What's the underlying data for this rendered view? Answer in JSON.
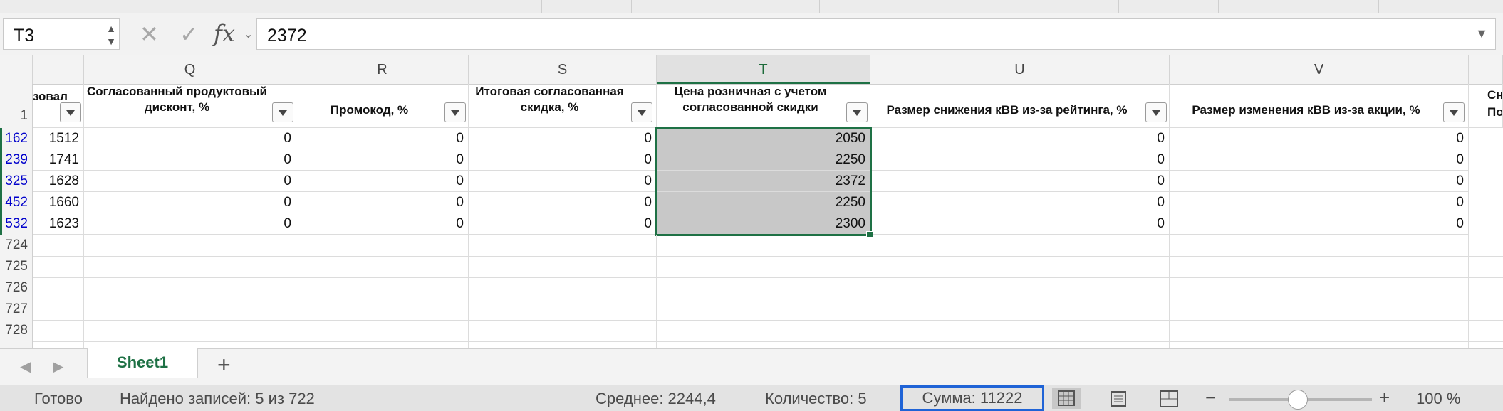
{
  "formula_bar": {
    "name_box": "T3",
    "fx_label": "fx",
    "formula": "2372"
  },
  "columns": [
    {
      "letter": "Q",
      "selected": false
    },
    {
      "letter": "R",
      "selected": false
    },
    {
      "letter": "S",
      "selected": false
    },
    {
      "letter": "T",
      "selected": true
    },
    {
      "letter": "U",
      "selected": false
    },
    {
      "letter": "V",
      "selected": false
    }
  ],
  "header_row_number": "1",
  "headers": {
    "p_partial": "зовал",
    "q": "Согласованный продуктовый дисконт, %",
    "r": "Промокод, %",
    "s": "Итоговая согласованная скидка, %",
    "t": "Цена розничная с учетом согласованной скидки",
    "u": "Размер снижения кВВ из-за рейтинга, %",
    "v": "Размер изменения кВВ из-за акции, %",
    "w_partial_top": "Сн",
    "w_partial_bottom": "По"
  },
  "rows": [
    {
      "num": "162",
      "p": "1512",
      "q": "0",
      "r": "0",
      "s": "0",
      "t": "2050",
      "u": "0",
      "v": "0"
    },
    {
      "num": "239",
      "p": "1741",
      "q": "0",
      "r": "0",
      "s": "0",
      "t": "2250",
      "u": "0",
      "v": "0"
    },
    {
      "num": "325",
      "p": "1628",
      "q": "0",
      "r": "0",
      "s": "0",
      "t": "2372",
      "u": "0",
      "v": "0"
    },
    {
      "num": "452",
      "p": "1660",
      "q": "0",
      "r": "0",
      "s": "0",
      "t": "2250",
      "u": "0",
      "v": "0"
    },
    {
      "num": "532",
      "p": "1623",
      "q": "0",
      "r": "0",
      "s": "0",
      "t": "2300",
      "u": "0",
      "v": "0"
    }
  ],
  "empty_rows": [
    "724",
    "725",
    "726",
    "727",
    "728"
  ],
  "sheet_tabs": {
    "active": "Sheet1",
    "add_label": "+"
  },
  "status": {
    "ready": "Готово",
    "found": "Найдено записей: 5 из 722",
    "average": "Среднее: 2244,4",
    "count": "Количество: 5",
    "sum": "Сумма: 11222",
    "zoom_minus": "−",
    "zoom_plus": "+",
    "zoom": "100 %",
    "zoom_level_fraction": 0.42
  },
  "colors": {
    "accent_green": "#1e7145",
    "filtered_row_blue": "#0000cc",
    "highlight_blue": "#1f63d6"
  }
}
